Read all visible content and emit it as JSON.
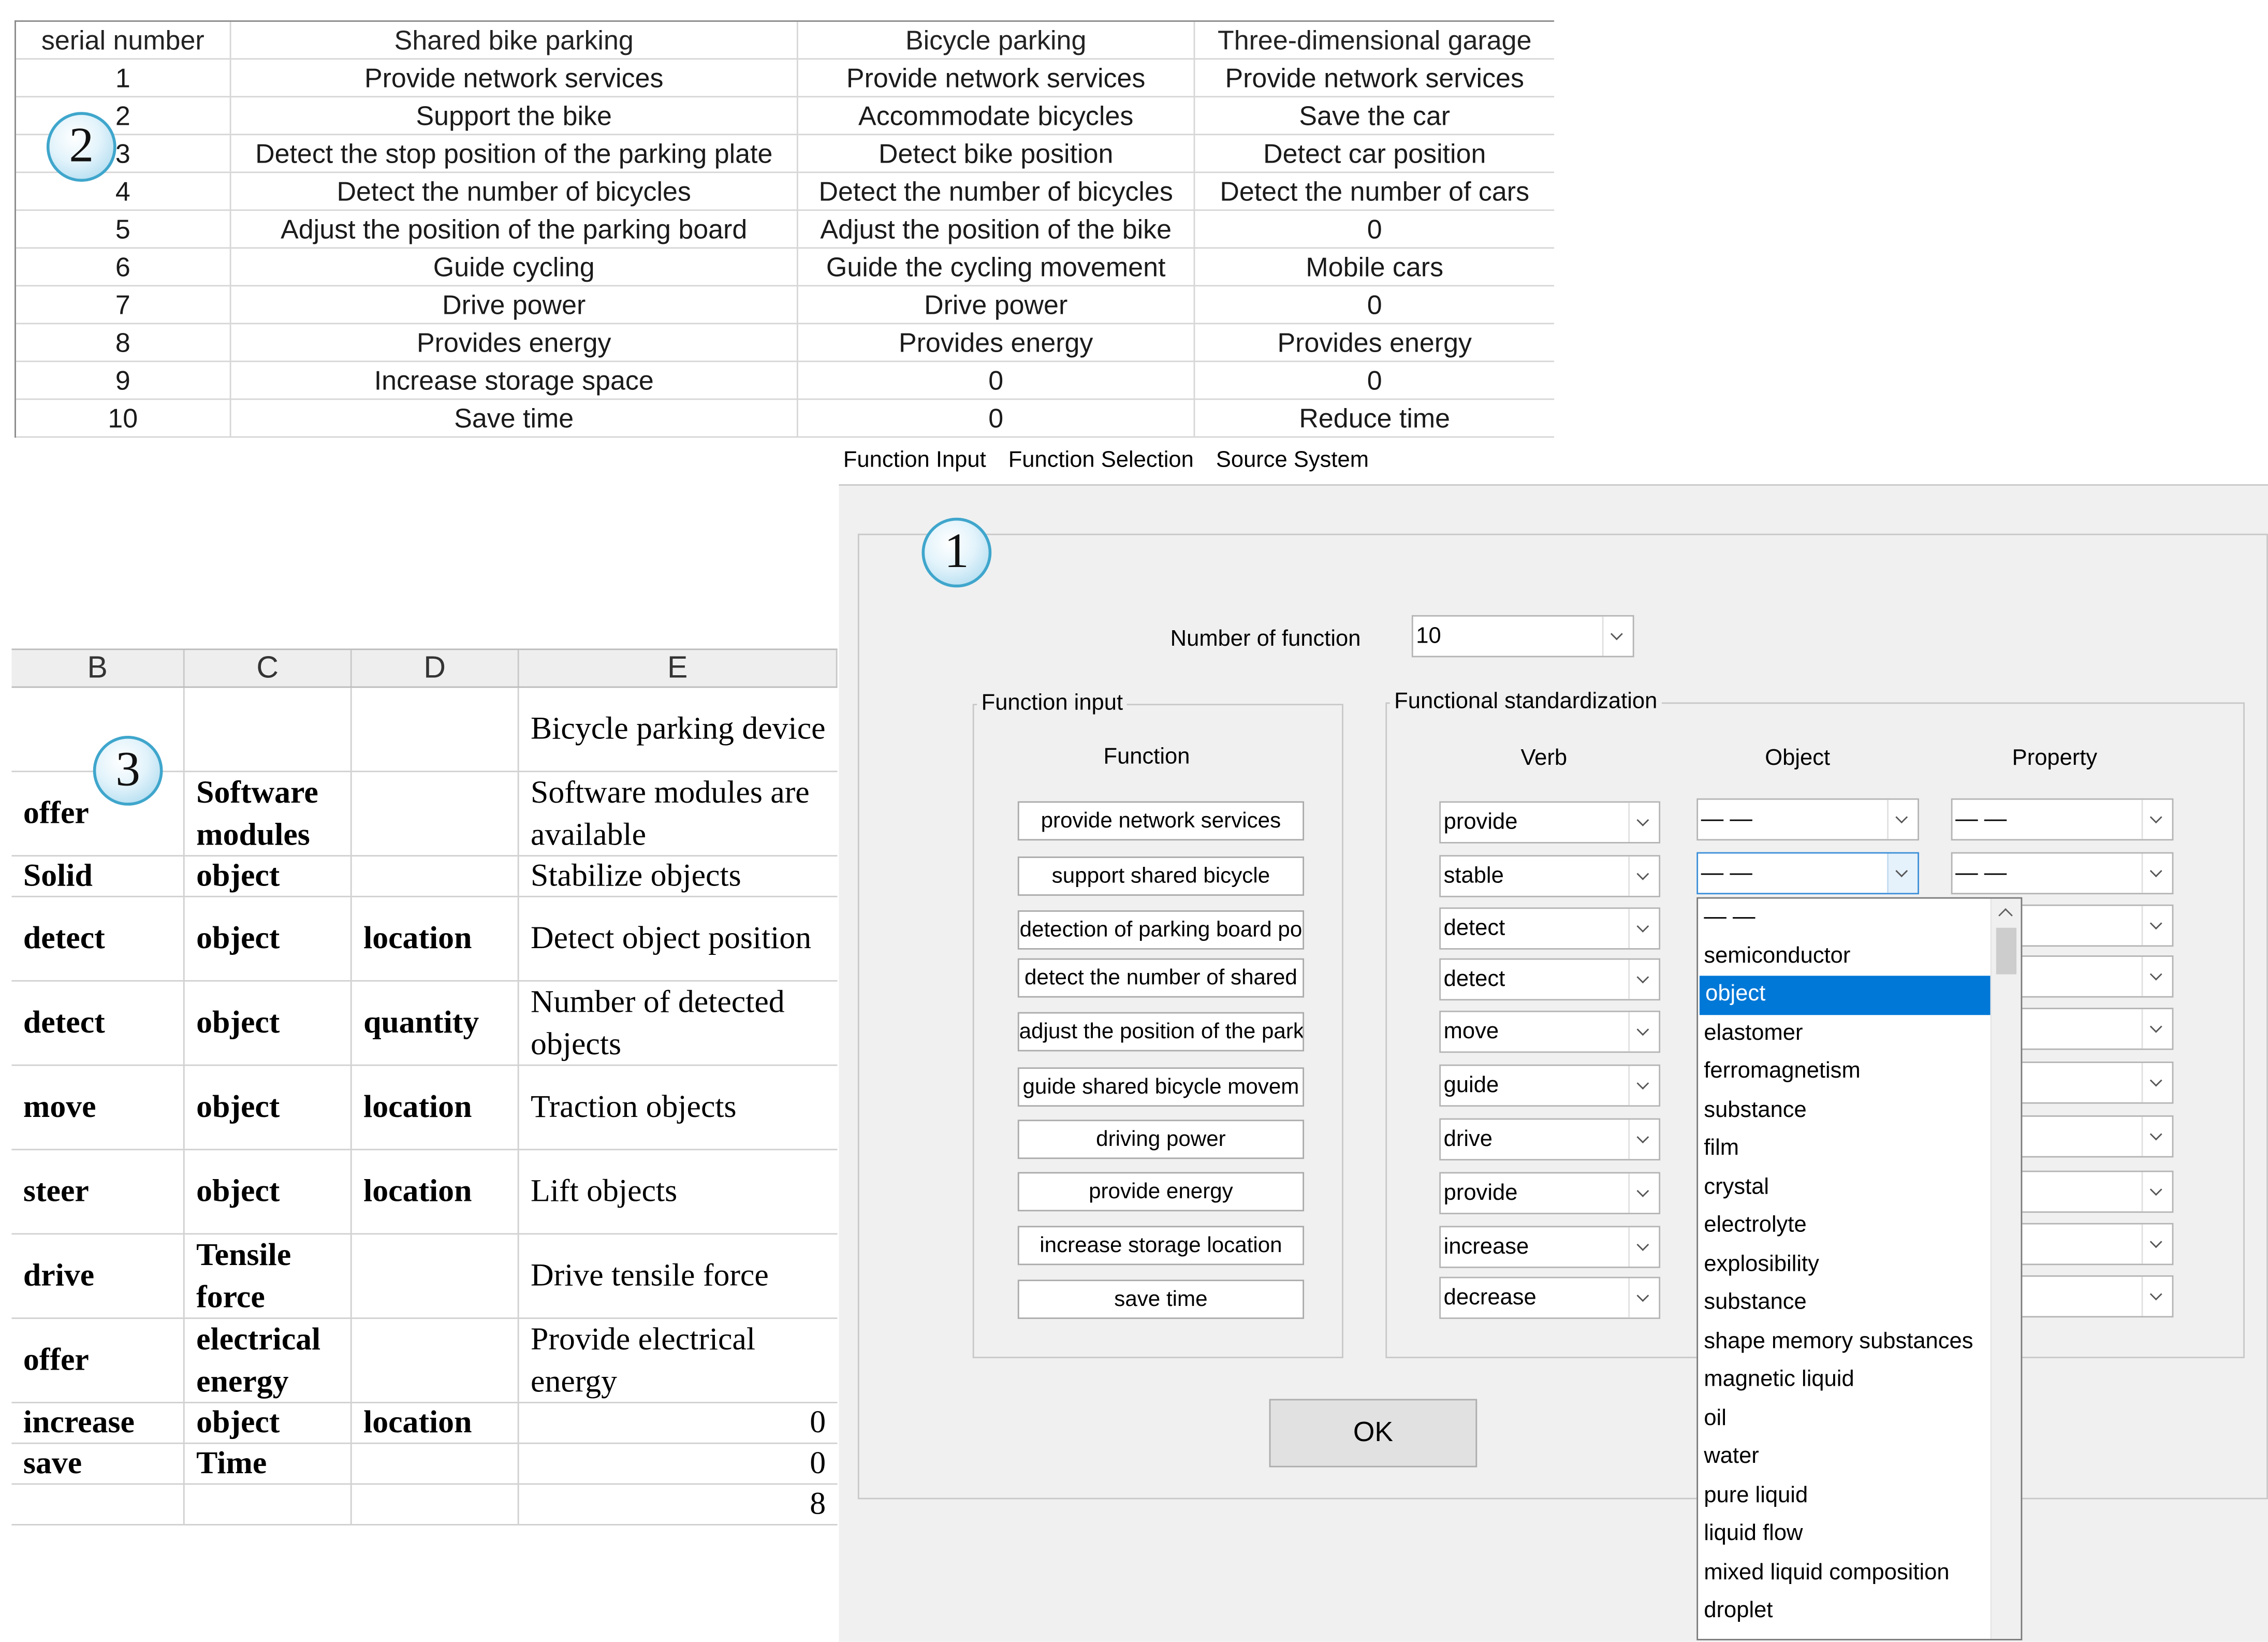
{
  "table2": {
    "header": [
      "serial number",
      "Shared bike parking",
      "Bicycle parking",
      "Three-dimensional garage"
    ],
    "rows": [
      [
        "1",
        "Provide network services",
        "Provide network services",
        "Provide network services"
      ],
      [
        "2",
        "Support the bike",
        "Accommodate bicycles",
        "Save the car"
      ],
      [
        "3",
        "Detect the stop position of the parking plate",
        "Detect bike position",
        "Detect car position"
      ],
      [
        "4",
        "Detect the number of bicycles",
        "Detect the number of bicycles",
        "Detect the number of cars"
      ],
      [
        "5",
        "Adjust the position of the parking board",
        "Adjust the position of the bike",
        "0"
      ],
      [
        "6",
        "Guide cycling",
        "Guide the cycling movement",
        "Mobile cars"
      ],
      [
        "7",
        "Drive power",
        "Drive power",
        "0"
      ],
      [
        "8",
        "Provides energy",
        "Provides energy",
        "Provides energy"
      ],
      [
        "9",
        "Increase storage space",
        "0",
        "0"
      ],
      [
        "10",
        "Save time",
        "0",
        "Reduce time"
      ]
    ]
  },
  "table3": {
    "columns": [
      "B",
      "C",
      "D",
      "E"
    ],
    "rows": [
      [
        "",
        "",
        "",
        "Bicycle parking device"
      ],
      [
        "offer",
        "Software modules",
        "",
        "Software modules are available"
      ],
      [
        "Solid",
        "object",
        "",
        "Stabilize objects"
      ],
      [
        "detect",
        "object",
        "location",
        "Detect object position"
      ],
      [
        "detect",
        "object",
        "quantity",
        "Number of detected objects"
      ],
      [
        "move",
        "object",
        "location",
        "Traction objects"
      ],
      [
        "steer",
        "object",
        "location",
        "Lift objects"
      ],
      [
        "drive",
        "Tensile force",
        "",
        "Drive tensile force"
      ],
      [
        "offer",
        "electrical energy",
        "",
        "Provide electrical energy"
      ],
      [
        "increase",
        "object",
        "location",
        "0"
      ],
      [
        "save",
        "Time",
        "",
        "0"
      ],
      [
        "",
        "",
        "",
        "8"
      ]
    ]
  },
  "menu": [
    "Function Input",
    "Function Selection",
    "Source System"
  ],
  "dialog": {
    "number_label": "Number of function",
    "number_value": "10",
    "function_input_title": "Function input",
    "function_header": "Function",
    "functions": [
      "provide network services",
      "support shared bicycle",
      "detection of parking board po",
      "detect the number of shared",
      "adjust the position of the park",
      "guide shared bicycle movem",
      "driving power",
      "provide energy",
      "increase storage location",
      "save time"
    ],
    "standardization_title": "Functional standardization",
    "verb_header": "Verb",
    "object_header": "Object",
    "property_header": "Property",
    "verbs": [
      "provide",
      "stable",
      "detect",
      "detect",
      "move",
      "guide",
      "drive",
      "provide",
      "increase",
      "decrease"
    ],
    "object_values": [
      "— —",
      "— —"
    ],
    "property_values": [
      "— —",
      "— —"
    ],
    "ok_label": "OK"
  },
  "dropdown_list": {
    "items": [
      "— —",
      "semiconductor",
      "object",
      "elastomer",
      "ferromagnetism",
      "substance",
      "film",
      "crystal",
      "electrolyte",
      "explosibility",
      "substance",
      "shape memory substances",
      "magnetic liquid",
      "oil",
      "water",
      "pure liquid",
      "liquid flow",
      "mixed liquid composition",
      "droplet"
    ],
    "selected": "object"
  },
  "badges": {
    "one": "1",
    "two": "2",
    "three": "3"
  },
  "colors": {
    "selection": "#0078d7",
    "dialog_bg": "#f0f0f0",
    "badge_border": "#3fa6cc"
  }
}
